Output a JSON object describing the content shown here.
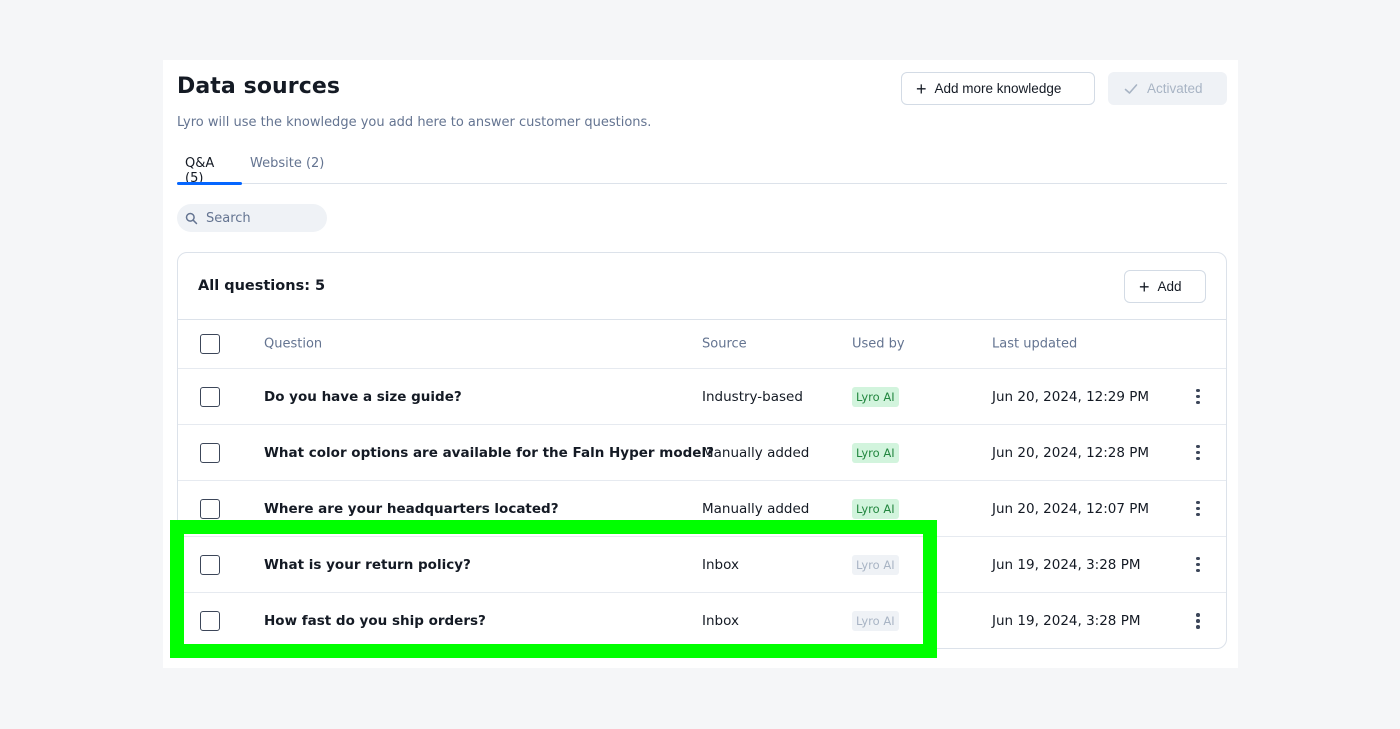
{
  "header": {
    "title": "Data sources",
    "subtitle": "Lyro will use the knowledge you add here to answer customer questions.",
    "add_knowledge_label": "Add more knowledge",
    "activated_label": "Activated"
  },
  "tabs": [
    {
      "label": "Q&A (5)",
      "active": true
    },
    {
      "label": "Website (2)",
      "active": false
    }
  ],
  "search": {
    "placeholder": "Search",
    "value": ""
  },
  "table": {
    "title": "All questions: 5",
    "add_label": "Add",
    "columns": {
      "question": "Question",
      "source": "Source",
      "used_by": "Used by",
      "last_updated": "Last updated"
    },
    "rows": [
      {
        "question": "Do you have a size guide?",
        "source": "Industry-based",
        "used_by": "Lyro AI",
        "active": true,
        "last_updated": "Jun 20, 2024, 12:29 PM"
      },
      {
        "question": "What color options are available for the Faln Hyper model?",
        "source": "Manually added",
        "used_by": "Lyro AI",
        "active": true,
        "last_updated": "Jun 20, 2024, 12:28 PM"
      },
      {
        "question": "Where are your headquarters located?",
        "source": "Manually added",
        "used_by": "Lyro AI",
        "active": true,
        "last_updated": "Jun 20, 2024, 12:07 PM"
      },
      {
        "question": "What is your return policy?",
        "source": "Inbox",
        "used_by": "Lyro AI",
        "active": false,
        "last_updated": "Jun 19, 2024, 3:28 PM"
      },
      {
        "question": "How fast do you ship orders?",
        "source": "Inbox",
        "used_by": "Lyro AI",
        "active": false,
        "last_updated": "Jun 19, 2024, 3:28 PM"
      }
    ]
  },
  "colors": {
    "accent": "#0566ff",
    "highlight": "#00ff00",
    "badge_active_bg": "#d2f4dd",
    "badge_active_text": "#22863f",
    "badge_inactive_bg": "#eff2f6",
    "badge_inactive_text": "#a8b4c4"
  },
  "icons": [
    "plus-icon",
    "check-icon",
    "search-icon",
    "kebab-menu-icon"
  ]
}
